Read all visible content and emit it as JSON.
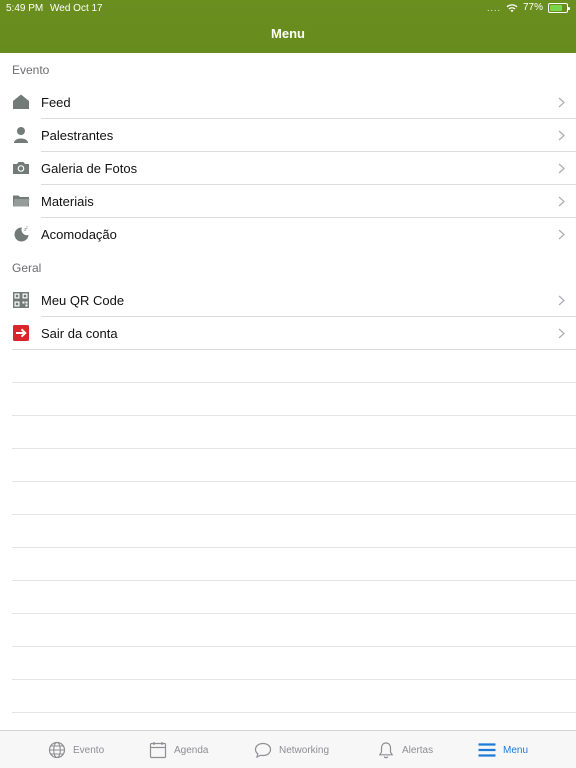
{
  "status_bar": {
    "time": "5:49 PM",
    "date": "Wed Oct 17",
    "signal": "....",
    "battery_percent": "77%",
    "battery_level": 0.77
  },
  "nav": {
    "title": "Menu"
  },
  "sections": [
    {
      "title": "Evento",
      "items": [
        {
          "label": "Feed",
          "icon": "home-icon"
        },
        {
          "label": "Palestrantes",
          "icon": "person-icon"
        },
        {
          "label": "Galeria de Fotos",
          "icon": "camera-icon"
        },
        {
          "label": "Materiais",
          "icon": "folder-icon"
        },
        {
          "label": "Acomodação",
          "icon": "moon-icon"
        }
      ]
    },
    {
      "title": "Geral",
      "items": [
        {
          "label": "Meu QR Code",
          "icon": "qr-code-icon"
        },
        {
          "label": "Sair da conta",
          "icon": "logout-icon"
        }
      ]
    }
  ],
  "tab_bar": {
    "tabs": [
      {
        "label": "Evento",
        "icon": "globe-icon",
        "active": false
      },
      {
        "label": "Agenda",
        "icon": "calendar-icon",
        "active": false
      },
      {
        "label": "Networking",
        "icon": "chat-bubble-icon",
        "active": false
      },
      {
        "label": "Alertas",
        "icon": "bell-icon",
        "active": false
      },
      {
        "label": "Menu",
        "icon": "menu-icon",
        "active": true
      }
    ]
  },
  "colors": {
    "header": "#6a8f1f",
    "active_tab": "#1e7bd8",
    "inactive_tab": "#8e8e93",
    "logout_icon": "#d9262c"
  }
}
